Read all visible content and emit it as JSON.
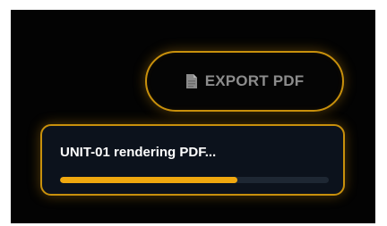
{
  "export_button": {
    "icon": "document-icon",
    "label": "EXPORT PDF"
  },
  "progress": {
    "status_text": "UNIT-01 rendering PDF...",
    "percent": 66
  },
  "colors": {
    "accent": "#f0a80f",
    "border": "#c8900c",
    "background": "#030303",
    "card": "#0c121c",
    "track": "#1e2733"
  }
}
